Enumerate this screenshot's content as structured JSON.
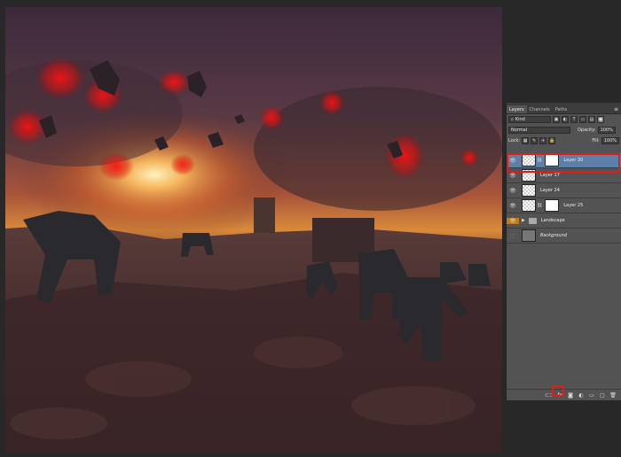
{
  "panel": {
    "tabs": [
      "Layers",
      "Channels",
      "Paths"
    ],
    "menu_icon": "panel-menu-icon",
    "filter_kind": "Kind",
    "blend_mode": "Normal",
    "opacity_label": "Opacity:",
    "opacity_value": "100%",
    "lock_label": "Lock:",
    "fill_label": "Fill:",
    "fill_value": "100%",
    "layers": [
      {
        "name": "Layer 30",
        "selected": true,
        "visible": true,
        "mask": true
      },
      {
        "name": "Layer 17",
        "selected": false,
        "visible": true,
        "mask": false
      },
      {
        "name": "Layer 24",
        "selected": false,
        "visible": true,
        "mask": false
      },
      {
        "name": "Layer 25",
        "selected": false,
        "visible": true,
        "mask": true
      },
      {
        "name": "Landscape",
        "selected": false,
        "visible": true,
        "group": true
      },
      {
        "name": "Background",
        "selected": false,
        "visible": false,
        "background": true
      }
    ],
    "bottom_icons": [
      "link-layers-icon",
      "fx-icon",
      "add-mask-icon",
      "adjustment-icon",
      "new-group-icon",
      "new-layer-icon",
      "delete-icon"
    ],
    "bottom_labels": {
      "link": "⊂⊃",
      "fx": "fx",
      "mask": "◙",
      "adjust": "◐",
      "group": "▭",
      "new": "▢",
      "delete": "🗑"
    }
  },
  "colors": {
    "highlight": "#e41b1b",
    "selected_layer": "#5d7fa8",
    "panel_bg": "#535353"
  }
}
